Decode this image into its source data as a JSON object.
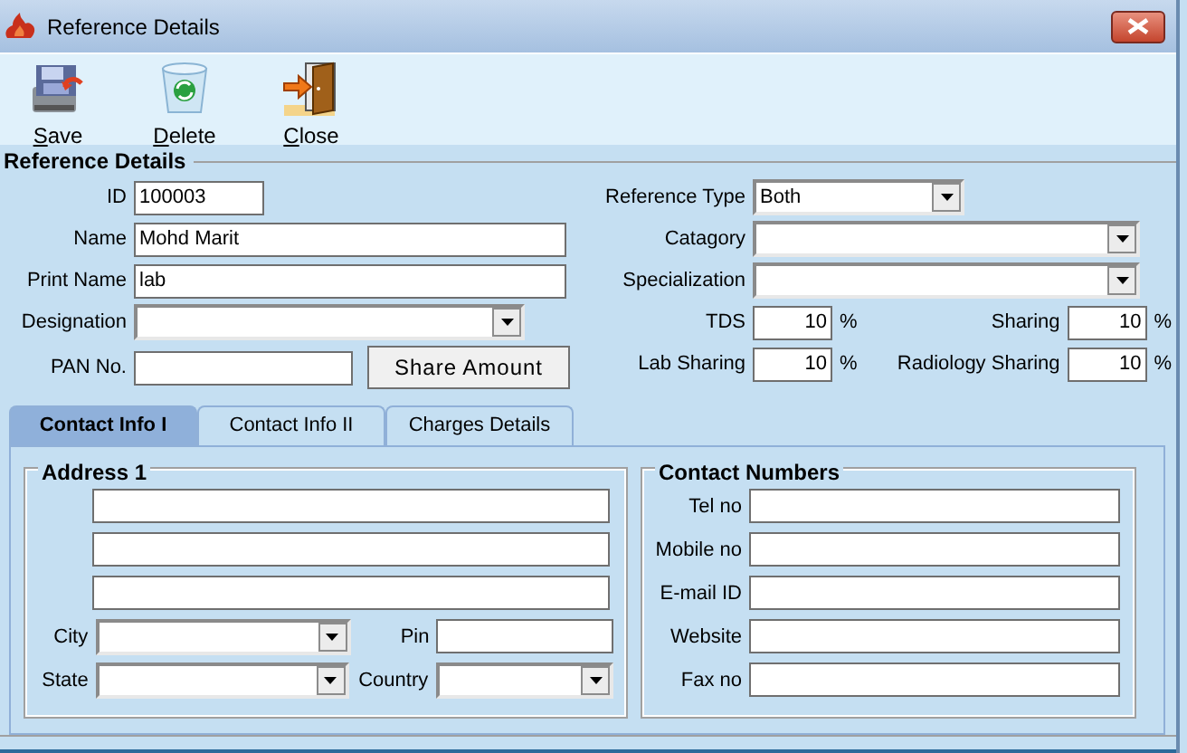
{
  "window": {
    "title": "Reference Details"
  },
  "toolbar": [
    {
      "kind": "save",
      "label": "Save"
    },
    {
      "kind": "delete",
      "label": "Delete"
    },
    {
      "kind": "close",
      "label": "Close"
    }
  ],
  "section_title": "Reference Details",
  "left_fields": [
    {
      "label": "ID",
      "kind": "text",
      "value": "100003"
    },
    {
      "label": "Name",
      "kind": "text",
      "value": "Mohd Marit"
    },
    {
      "label": "Print Name",
      "kind": "text",
      "value": "lab"
    },
    {
      "label": "Designation",
      "kind": "combo"
    },
    {
      "label": "PAN No.",
      "kind": "text"
    }
  ],
  "share_button": "Share Amount",
  "right_fields": [
    {
      "label": "Reference Type",
      "kind": "combo",
      "value": "Both"
    },
    {
      "label": "Catagory",
      "kind": "combo"
    },
    {
      "label": "Specialization",
      "kind": "combo"
    }
  ],
  "percent_rows": [
    [
      {
        "label": "TDS",
        "value": "10",
        "unit": "%"
      },
      {
        "label": "Sharing",
        "value": "10",
        "unit": "%"
      }
    ],
    [
      {
        "label": "Lab Sharing",
        "value": "10",
        "unit": "%"
      },
      {
        "label": "Radiology Sharing",
        "value": "10",
        "unit": "%"
      }
    ]
  ],
  "tabs": [
    {
      "label": "Contact Info I",
      "selected": true
    },
    {
      "label": "Contact Info II",
      "selected": false
    },
    {
      "label": "Charges Details",
      "selected": false
    }
  ],
  "address": {
    "title": "Address 1",
    "lines": [
      {
        "kind": "text"
      },
      {
        "kind": "text"
      },
      {
        "kind": "text"
      }
    ],
    "rows": [
      [
        {
          "label": "City",
          "kind": "combo"
        },
        {
          "label": "Pin",
          "kind": "text"
        }
      ],
      [
        {
          "label": "State",
          "kind": "combo"
        },
        {
          "label": "Country",
          "kind": "combo"
        }
      ]
    ]
  },
  "contact": {
    "title": "Contact Numbers",
    "fields": [
      {
        "label": "Tel no"
      },
      {
        "label": "Mobile no"
      },
      {
        "label": "E-mail ID"
      },
      {
        "label": "Website"
      },
      {
        "label": "Fax no"
      }
    ]
  }
}
